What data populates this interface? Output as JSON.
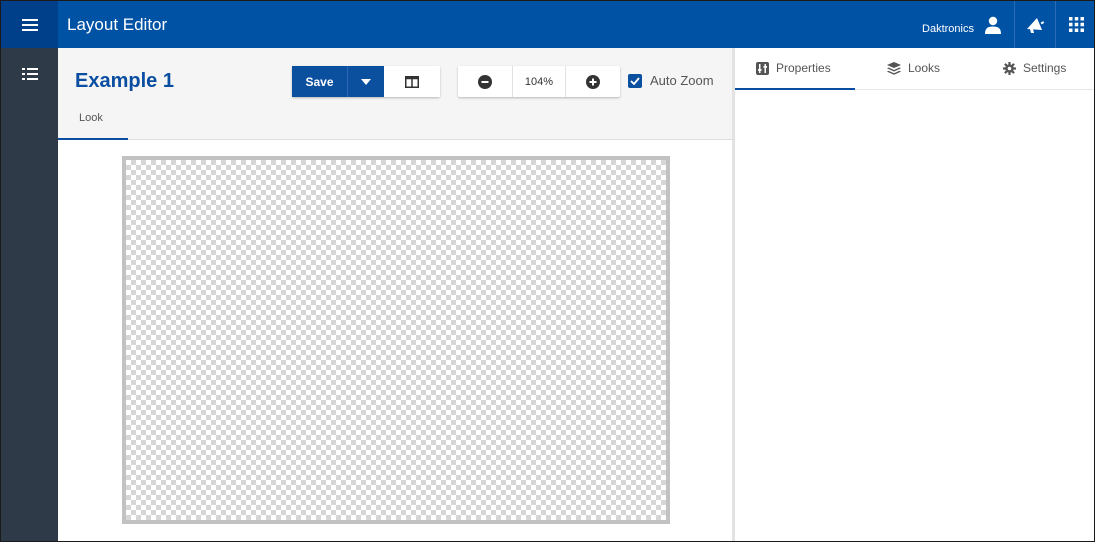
{
  "header": {
    "app_title": "Layout Editor",
    "user_name": "Daktronics"
  },
  "editor": {
    "doc_title": "Example 1",
    "tab_label": "Look",
    "save_label": "Save",
    "zoom_value": "104%",
    "auto_zoom_label": "Auto Zoom",
    "auto_zoom_checked": true
  },
  "panel": {
    "tabs": [
      {
        "label": "Properties",
        "icon": "properties-icon",
        "active": true
      },
      {
        "label": "Looks",
        "icon": "layers-icon",
        "active": false
      },
      {
        "label": "Settings",
        "icon": "gear-icon",
        "active": false
      }
    ]
  },
  "colors": {
    "accent": "#0052a5",
    "rail": "#2f3a48",
    "save": "#0b4f9f"
  }
}
